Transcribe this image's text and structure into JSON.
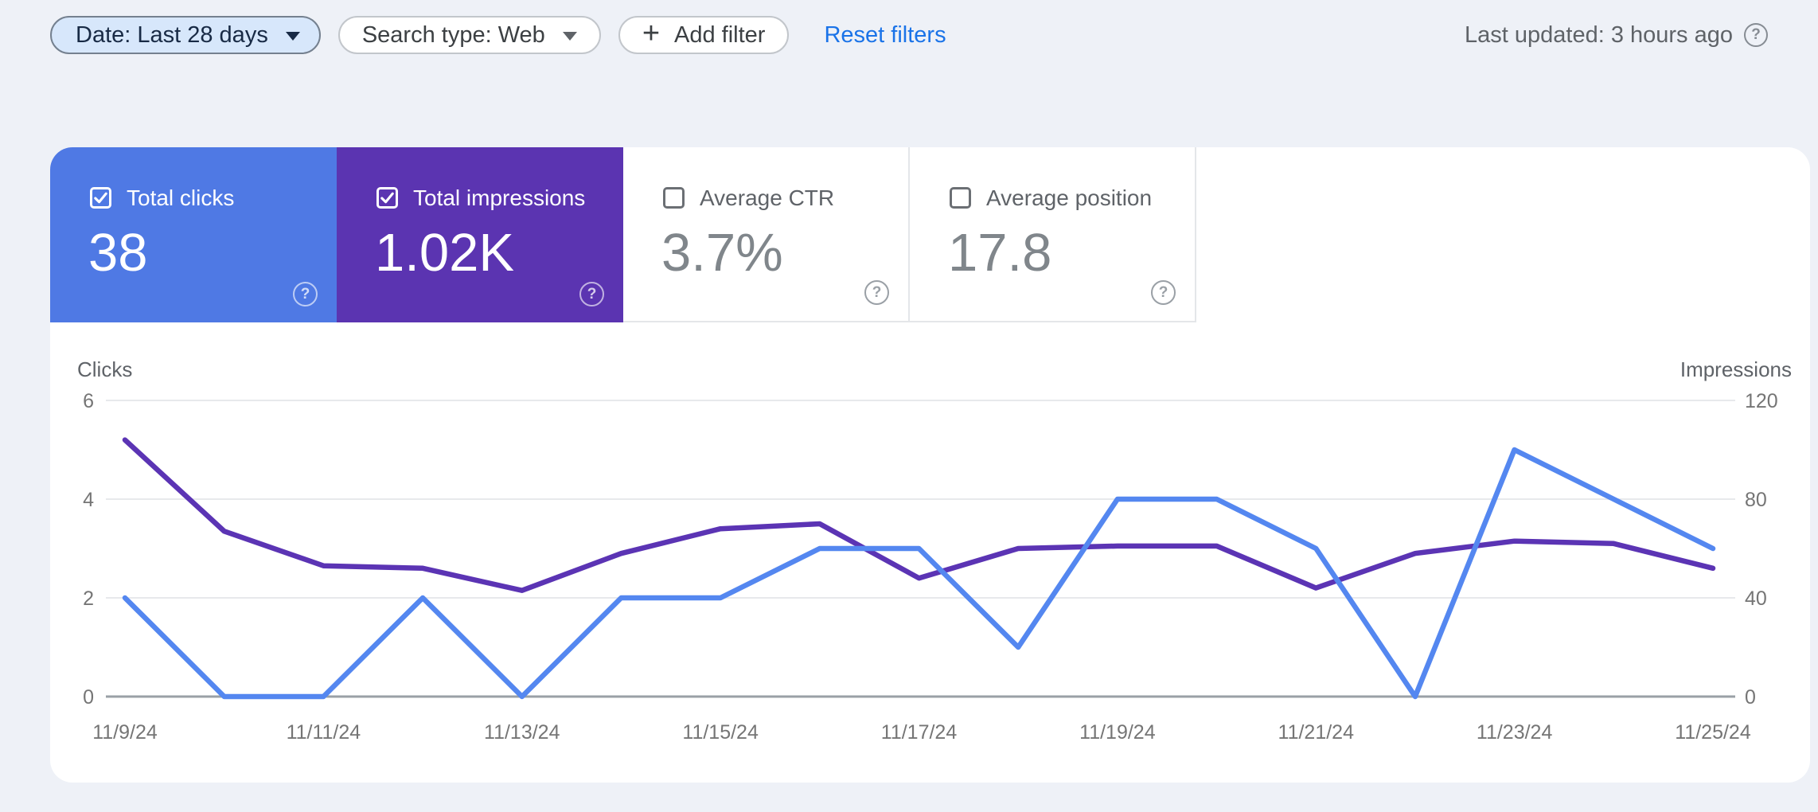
{
  "toolbar": {
    "date_filter_label": "Date: Last 28 days",
    "search_type_label": "Search type: Web",
    "add_filter_label": "Add filter",
    "reset_filters_label": "Reset filters",
    "last_updated_label": "Last updated: 3 hours ago"
  },
  "icons": {
    "plus_glyph": "+",
    "help_glyph": "?"
  },
  "metric_cards": [
    {
      "id": "total-clicks",
      "label": "Total clicks",
      "value": "38",
      "checked": true,
      "bg": "#4f79e4"
    },
    {
      "id": "total-impressions",
      "label": "Total impressions",
      "value": "1.02K",
      "checked": true,
      "bg": "#5b34b1"
    },
    {
      "id": "average-ctr",
      "label": "Average CTR",
      "value": "3.7%",
      "checked": false,
      "bg": "#ffffff"
    },
    {
      "id": "average-position",
      "label": "Average position",
      "value": "17.8",
      "checked": false,
      "bg": "#ffffff"
    }
  ],
  "chart_data": {
    "type": "line",
    "x": [
      "11/9/24",
      "11/10/24",
      "11/11/24",
      "11/12/24",
      "11/13/24",
      "11/14/24",
      "11/15/24",
      "11/16/24",
      "11/17/24",
      "11/18/24",
      "11/19/24",
      "11/20/24",
      "11/21/24",
      "11/22/24",
      "11/23/24",
      "11/24/24",
      "11/25/24"
    ],
    "x_tick_labels": [
      "11/9/24",
      "11/11/24",
      "11/13/24",
      "11/15/24",
      "11/17/24",
      "11/19/24",
      "11/21/24",
      "11/23/24",
      "11/25/24"
    ],
    "series": [
      {
        "name": "Clicks",
        "axis": "left",
        "color": "#5487f0",
        "values": [
          2,
          0,
          0,
          2,
          0,
          2,
          2,
          3,
          3,
          1,
          4,
          4,
          3,
          0,
          5,
          4,
          3
        ]
      },
      {
        "name": "Impressions",
        "axis": "right",
        "color": "#5b34b4",
        "values": [
          104,
          67,
          53,
          52,
          43,
          58,
          68,
          70,
          48,
          60,
          61,
          61,
          44,
          58,
          63,
          62,
          52
        ]
      }
    ],
    "left_axis": {
      "title": "Clicks",
      "ticks": [
        6,
        4,
        2,
        0
      ],
      "range": [
        0,
        6
      ]
    },
    "right_axis": {
      "title": "Impressions",
      "ticks": [
        120,
        80,
        40,
        0
      ],
      "range": [
        0,
        120
      ]
    },
    "grid": true,
    "legend_position": "none"
  },
  "colors": {
    "page_bg": "#eef1f7",
    "card_bg": "#ffffff",
    "grid_line": "#e7e9ec",
    "baseline": "#9aa0a6",
    "tick_text": "#757575",
    "axis_title_text": "#5f6368",
    "link_blue": "#1a73e8",
    "clicks_accent": "#4f79e4",
    "impressions_accent": "#5b34b1"
  }
}
